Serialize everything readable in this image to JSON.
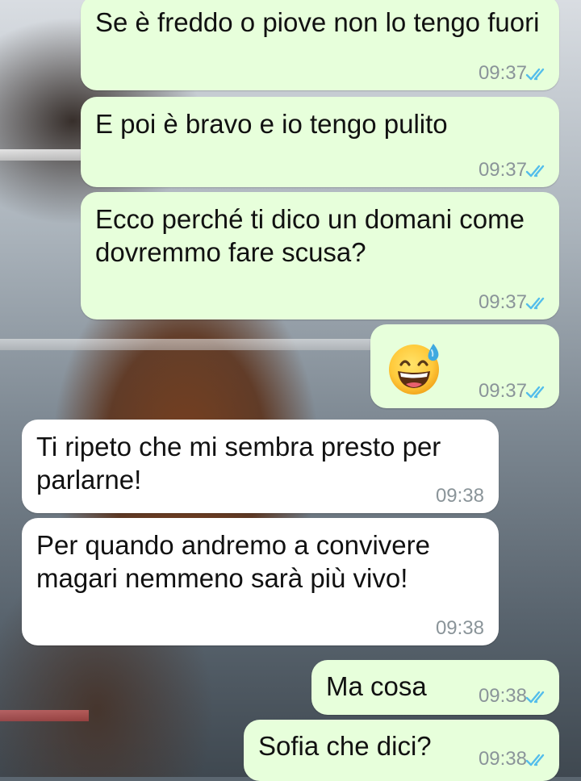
{
  "messages": [
    {
      "id": "m1",
      "direction": "out",
      "text": "Se è freddo o piove non lo tengo fuori",
      "time": "09:37",
      "status": "read"
    },
    {
      "id": "m2",
      "direction": "out",
      "text": "E poi è bravo e io tengo pulito",
      "time": "09:37",
      "status": "read"
    },
    {
      "id": "m3",
      "direction": "out",
      "text": "Ecco perché ti dico un domani come dovremmo fare scusa?",
      "time": "09:37",
      "status": "read"
    },
    {
      "id": "m4",
      "direction": "out",
      "emoji": "grinning-face-with-sweat",
      "time": "09:37",
      "status": "read"
    },
    {
      "id": "m5",
      "direction": "in",
      "text": "Ti ripeto che mi sembra presto per parlarne!",
      "time": "09:38"
    },
    {
      "id": "m6",
      "direction": "in",
      "text": "Per quando andremo a convivere magari nemmeno sarà più vivo!",
      "time": "09:38"
    },
    {
      "id": "m7",
      "direction": "out",
      "text": "Ma cosa",
      "time": "09:38",
      "status": "read"
    },
    {
      "id": "m8",
      "direction": "out",
      "text": "Sofia che dici?",
      "time": "09:38",
      "status": "read"
    }
  ],
  "colors": {
    "outgoing_bubble": "#e7ffdb",
    "incoming_bubble": "#ffffff",
    "read_ticks": "#53bdeb",
    "timestamp": "#8a9499"
  }
}
